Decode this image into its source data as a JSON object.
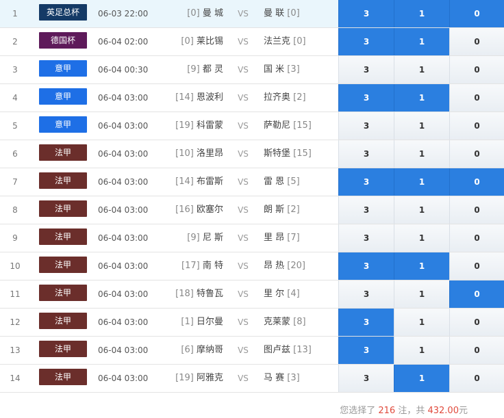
{
  "leagues": {
    "yingzu": {
      "name": "英足总杯",
      "color": "#143a66"
    },
    "deguo": {
      "name": "德国杯",
      "color": "#5e1a5a"
    },
    "yijia": {
      "name": "意甲",
      "color": "#1e6fe6"
    },
    "fajia": {
      "name": "法甲",
      "color": "#6b2e2b"
    }
  },
  "vs_label": "VS",
  "matches": [
    {
      "no": "1",
      "league": "英足总杯",
      "league_color": "#143a66",
      "time": "06-03 22:00",
      "home_rank": "[0]",
      "home": "曼 城",
      "away": "曼 联",
      "away_rank": "[0]",
      "odds": [
        "3",
        "1",
        "0"
      ],
      "selected": [
        true,
        true,
        true
      ]
    },
    {
      "no": "2",
      "league": "德国杯",
      "league_color": "#5e1a5a",
      "time": "06-04 02:00",
      "home_rank": "[0]",
      "home": "莱比锡",
      "away": "法兰克",
      "away_rank": "[0]",
      "odds": [
        "3",
        "1",
        "0"
      ],
      "selected": [
        true,
        true,
        false
      ]
    },
    {
      "no": "3",
      "league": "意甲",
      "league_color": "#1e6fe6",
      "time": "06-04 00:30",
      "home_rank": "[9]",
      "home": "都 灵",
      "away": "国 米",
      "away_rank": "[3]",
      "odds": [
        "3",
        "1",
        "0"
      ],
      "selected": [
        false,
        false,
        false
      ]
    },
    {
      "no": "4",
      "league": "意甲",
      "league_color": "#1e6fe6",
      "time": "06-04 03:00",
      "home_rank": "[14]",
      "home": "恩波利",
      "away": "拉齐奥",
      "away_rank": "[2]",
      "odds": [
        "3",
        "1",
        "0"
      ],
      "selected": [
        true,
        true,
        false
      ]
    },
    {
      "no": "5",
      "league": "意甲",
      "league_color": "#1e6fe6",
      "time": "06-04 03:00",
      "home_rank": "[19]",
      "home": "科雷蒙",
      "away": "萨勒尼",
      "away_rank": "[15]",
      "odds": [
        "3",
        "1",
        "0"
      ],
      "selected": [
        false,
        false,
        false
      ]
    },
    {
      "no": "6",
      "league": "法甲",
      "league_color": "#6b2e2b",
      "time": "06-04 03:00",
      "home_rank": "[10]",
      "home": "洛里昂",
      "away": "斯特堡",
      "away_rank": "[15]",
      "odds": [
        "3",
        "1",
        "0"
      ],
      "selected": [
        false,
        false,
        false
      ]
    },
    {
      "no": "7",
      "league": "法甲",
      "league_color": "#6b2e2b",
      "time": "06-04 03:00",
      "home_rank": "[14]",
      "home": "布雷斯",
      "away": "雷 恩",
      "away_rank": "[5]",
      "odds": [
        "3",
        "1",
        "0"
      ],
      "selected": [
        true,
        true,
        true
      ]
    },
    {
      "no": "8",
      "league": "法甲",
      "league_color": "#6b2e2b",
      "time": "06-04 03:00",
      "home_rank": "[16]",
      "home": "欧塞尔",
      "away": "朗 斯",
      "away_rank": "[2]",
      "odds": [
        "3",
        "1",
        "0"
      ],
      "selected": [
        false,
        false,
        false
      ]
    },
    {
      "no": "9",
      "league": "法甲",
      "league_color": "#6b2e2b",
      "time": "06-04 03:00",
      "home_rank": "[9]",
      "home": "尼 斯",
      "away": "里 昂",
      "away_rank": "[7]",
      "odds": [
        "3",
        "1",
        "0"
      ],
      "selected": [
        false,
        false,
        false
      ]
    },
    {
      "no": "10",
      "league": "法甲",
      "league_color": "#6b2e2b",
      "time": "06-04 03:00",
      "home_rank": "[17]",
      "home": "南 特",
      "away": "昂 热",
      "away_rank": "[20]",
      "odds": [
        "3",
        "1",
        "0"
      ],
      "selected": [
        true,
        true,
        false
      ]
    },
    {
      "no": "11",
      "league": "法甲",
      "league_color": "#6b2e2b",
      "time": "06-04 03:00",
      "home_rank": "[18]",
      "home": "特鲁瓦",
      "away": "里 尔",
      "away_rank": "[4]",
      "odds": [
        "3",
        "1",
        "0"
      ],
      "selected": [
        false,
        false,
        true
      ]
    },
    {
      "no": "12",
      "league": "法甲",
      "league_color": "#6b2e2b",
      "time": "06-04 03:00",
      "home_rank": "[1]",
      "home": "日尔曼",
      "away": "克莱蒙",
      "away_rank": "[8]",
      "odds": [
        "3",
        "1",
        "0"
      ],
      "selected": [
        true,
        false,
        false
      ]
    },
    {
      "no": "13",
      "league": "法甲",
      "league_color": "#6b2e2b",
      "time": "06-04 03:00",
      "home_rank": "[6]",
      "home": "摩纳哥",
      "away": "图卢兹",
      "away_rank": "[13]",
      "odds": [
        "3",
        "1",
        "0"
      ],
      "selected": [
        true,
        false,
        false
      ]
    },
    {
      "no": "14",
      "league": "法甲",
      "league_color": "#6b2e2b",
      "time": "06-04 03:00",
      "home_rank": "[19]",
      "home": "阿雅克",
      "away": "马 赛",
      "away_rank": "[3]",
      "odds": [
        "3",
        "1",
        "0"
      ],
      "selected": [
        false,
        true,
        false
      ]
    }
  ],
  "summary": {
    "prefix": "您选择了",
    "count": "216",
    "mid": "注，共",
    "amount": "432.00",
    "suffix": "元"
  }
}
